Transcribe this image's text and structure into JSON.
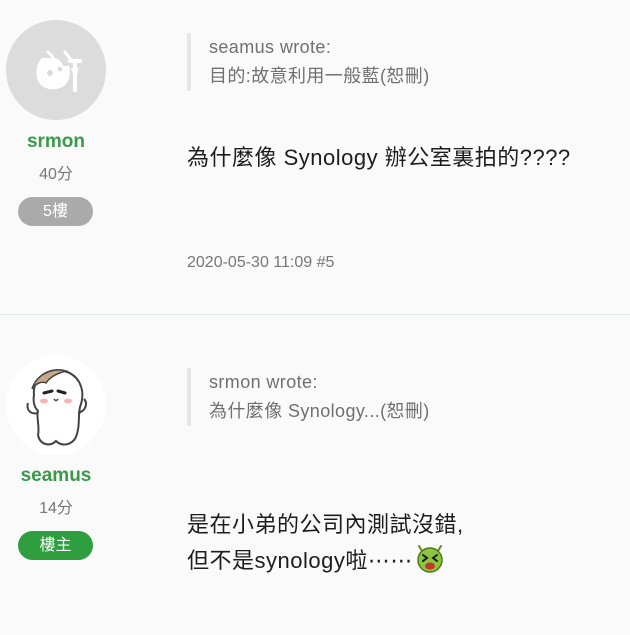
{
  "posts": [
    {
      "author": "srmon",
      "points": "40分",
      "badge": "5樓",
      "quote_header": "seamus wrote:",
      "quote_text": "目的:故意利用一般藍(恕刪)",
      "body": "為什麼像 Synology 辦公室裏拍的????",
      "timestamp": "2020-05-30 11:09 #5",
      "avatar_icon": "default-avatar-icon",
      "badge_color": "#aaaaaa"
    },
    {
      "author": "seamus",
      "points": "14分",
      "badge": "樓主",
      "quote_header": "srmon wrote:",
      "quote_text": "為什麼像 Synology...(恕刪)",
      "body_line1": "是在小弟的公司內測試沒錯,",
      "body_line2": "但不是synology啦⋯⋯",
      "avatar_icon": "cartoon-character-avatar-icon",
      "emoji_icon": "dizzy-green-face-emoji-icon",
      "badge_color": "#2e9e3e"
    }
  ],
  "colors": {
    "username": "#3a9a4a",
    "background": "#fafafa",
    "divider": "#dfe9e2"
  }
}
